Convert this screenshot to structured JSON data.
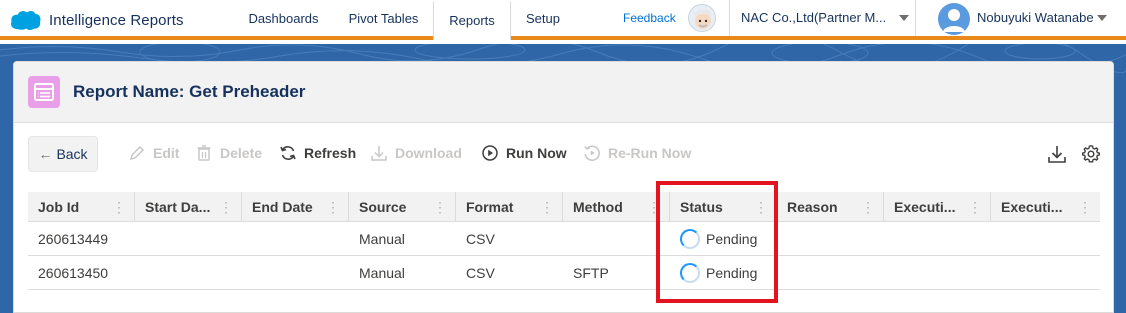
{
  "app": {
    "brand_name": "Intelligence Reports",
    "tabs": [
      {
        "label": "Dashboards",
        "active": false
      },
      {
        "label": "Pivot Tables",
        "active": false
      },
      {
        "label": "Reports",
        "active": true
      },
      {
        "label": "Setup",
        "active": false
      }
    ],
    "feedback_label": "Feedback",
    "org_name": "NAC Co.,Ltd(Partner M...",
    "user_name": "Nobuyuki Watanabe",
    "accent_color": "#e8891a"
  },
  "report": {
    "title": "Report Name: Get Preheader",
    "icon": "report-table-icon"
  },
  "toolbar": {
    "back_label": "Back",
    "edit_label": "Edit",
    "delete_label": "Delete",
    "refresh_label": "Refresh",
    "download_label": "Download",
    "run_now_label": "Run Now",
    "rerun_now_label": "Re-Run Now",
    "right_icons": [
      "download-icon",
      "gear-icon"
    ]
  },
  "table": {
    "columns": [
      "Job Id",
      "Start Da...",
      "End Date",
      "Source",
      "Format",
      "Method",
      "Status",
      "Reason",
      "Executi...",
      "Executi..."
    ],
    "rows": [
      {
        "job_id": "260613449",
        "start_date": "",
        "end_date": "",
        "source": "Manual",
        "format": "CSV",
        "method": "",
        "status": "Pending",
        "reason": "",
        "exec1": "",
        "exec2": ""
      },
      {
        "job_id": "260613450",
        "start_date": "",
        "end_date": "",
        "source": "Manual",
        "format": "CSV",
        "method": "SFTP",
        "status": "Pending",
        "reason": "",
        "exec1": "",
        "exec2": ""
      }
    ]
  },
  "highlight_color": "#e2141f"
}
